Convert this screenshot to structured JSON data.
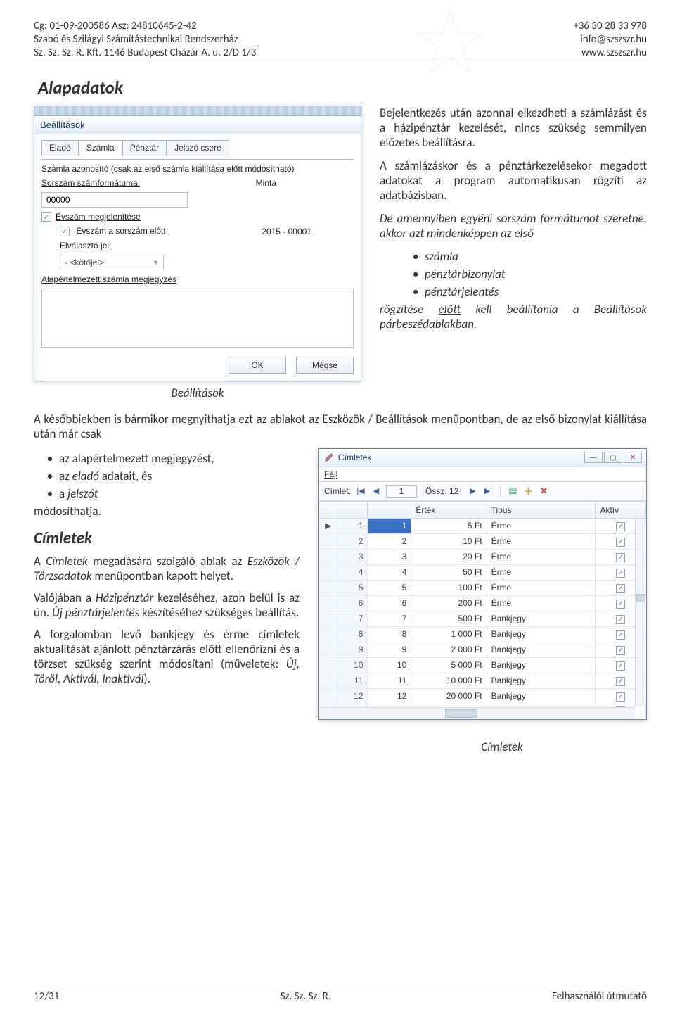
{
  "header": {
    "left1": "Cg: 01-09-200586 Asz: 24810645-2-42",
    "left2": "Szabó és Szilágyi Számítástechnikai Rendszerház",
    "left3": "Sz. Sz. Sz. R. Kft. 1146 Budapest Cházár A. u. 2/D 1/3",
    "right1": "+36 30 28 33 978",
    "right2": "info@szszszr.hu",
    "right3": "www.szszszr.hu"
  },
  "section1_title": "Alapadatok",
  "dialog1": {
    "title": "Beállítások",
    "tabs": [
      "Eladó",
      "Számla",
      "Pénztár",
      "Jelszó csere"
    ],
    "active_tab": 1,
    "hint": "Számla azonosító (csak az első számla kiállítása előtt módosítható)",
    "lbl_sorszam": "Sorszám számformátuma:",
    "lbl_minta": "Minta",
    "val_sorszam": "00000",
    "cb_evszam": "Évszám megjelenítése",
    "cb_evszam_sorszam": "Évszám a sorszám előtt",
    "sample": "2015 - 00001",
    "lbl_elvalaszto": "Elválasztó jel:",
    "combo_elvalaszto": "- <kötőjel>",
    "lbl_megjegyzes": "Alapértelmezett számla megjegyzés",
    "btn_ok": "OK",
    "btn_cancel": "Mégse"
  },
  "right_text": {
    "p1": "Bejelentkezés után azonnal elkezdheti a számlázást és a házipénztár kezelését, nincs szükség semmilyen előzetes beállításra.",
    "p2": "A számlázáskor és a pénztár­kezelésekor megadott adatokat a program automatikusan rögzíti az adatbázisban.",
    "p3a": "De amennyiben egyéni sorszám formátumot szeretne, akkor azt mindenképpen az első",
    "p3_items": [
      "számla",
      "pénztárbizonylat",
      "pénztárjelentés"
    ],
    "p3b_a": "rögzítése ",
    "p3b_u": "előtt",
    "p3b_b": " kell beállítania a Beállítások párbeszédablakban."
  },
  "caption1": "Beállítások",
  "mid_para": "A későbbiekben is bármikor megnyithatja ezt az ablakot az Eszközök / Beállítások menüpontban, de az első bizonylat kiállítása után már csak",
  "mid_items": {
    "i1": "az alapértelmezett megjegyzést,",
    "i2_a": "az ",
    "i2_b": "eladó",
    "i2_c": " adatait, és",
    "i3_a": "a ",
    "i3_b": "jelszót"
  },
  "mid_tail": "módosíthatja.",
  "section2_title": "Címletek",
  "left_text": {
    "p1_a": "A ",
    "p1_b": "Címletek",
    "p1_c": " megadására szolgáló ablak az ",
    "p1_d": "Eszközök / Törzsadatok",
    "p1_e": " menüpontban kapott helyet.",
    "p2_a": "Valójában a ",
    "p2_b": "Házipénztár",
    "p2_c": " kezeléséhez, azon belül is az ún. ",
    "p2_d": "Új pénztárjelentés",
    "p2_e": " készítéséhez szükséges beállítás.",
    "p3_a": "A forgalomban levő bankjegy és érme címletek aktualitását ajánlott pénztárzárás előtt ellenőrizni és a törzset szükség szerint módosítani (műveletek: ",
    "p3_b": "Új, Töröl, Aktivál, Inaktivál",
    "p3_c": ")."
  },
  "dialog2": {
    "title": "Címletek",
    "menu": "Fájl",
    "tool_label": "Címlet:",
    "counter": "1",
    "total_label": "Össz: 12",
    "columns": [
      "",
      "",
      "Érték",
      "Tipus",
      "Aktív"
    ],
    "rows": [
      {
        "n": 1,
        "v": 1,
        "ert": "5 Ft",
        "tip": "Érme",
        "akt": true
      },
      {
        "n": 2,
        "v": 2,
        "ert": "10 Ft",
        "tip": "Érme",
        "akt": true
      },
      {
        "n": 3,
        "v": 3,
        "ert": "20 Ft",
        "tip": "Érme",
        "akt": true
      },
      {
        "n": 4,
        "v": 4,
        "ert": "50 Ft",
        "tip": "Érme",
        "akt": true
      },
      {
        "n": 5,
        "v": 5,
        "ert": "100 Ft",
        "tip": "Érme",
        "akt": true
      },
      {
        "n": 6,
        "v": 6,
        "ert": "200 Ft",
        "tip": "Érme",
        "akt": true
      },
      {
        "n": 7,
        "v": 7,
        "ert": "500 Ft",
        "tip": "Bankjegy",
        "akt": true
      },
      {
        "n": 8,
        "v": 8,
        "ert": "1 000 Ft",
        "tip": "Bankjegy",
        "akt": true
      },
      {
        "n": 9,
        "v": 9,
        "ert": "2 000 Ft",
        "tip": "Bankjegy",
        "akt": true
      },
      {
        "n": 10,
        "v": 10,
        "ert": "5 000 Ft",
        "tip": "Bankjegy",
        "akt": true
      },
      {
        "n": 11,
        "v": 11,
        "ert": "10 000 Ft",
        "tip": "Bankjegy",
        "akt": true
      },
      {
        "n": 12,
        "v": 12,
        "ert": "20 000 Ft",
        "tip": "Bankjegy",
        "akt": true
      }
    ]
  },
  "caption2": "Címletek",
  "footer": {
    "left": "12/31",
    "center": "Sz. Sz. Sz. R.",
    "right": "Felhasználói útmutató"
  }
}
